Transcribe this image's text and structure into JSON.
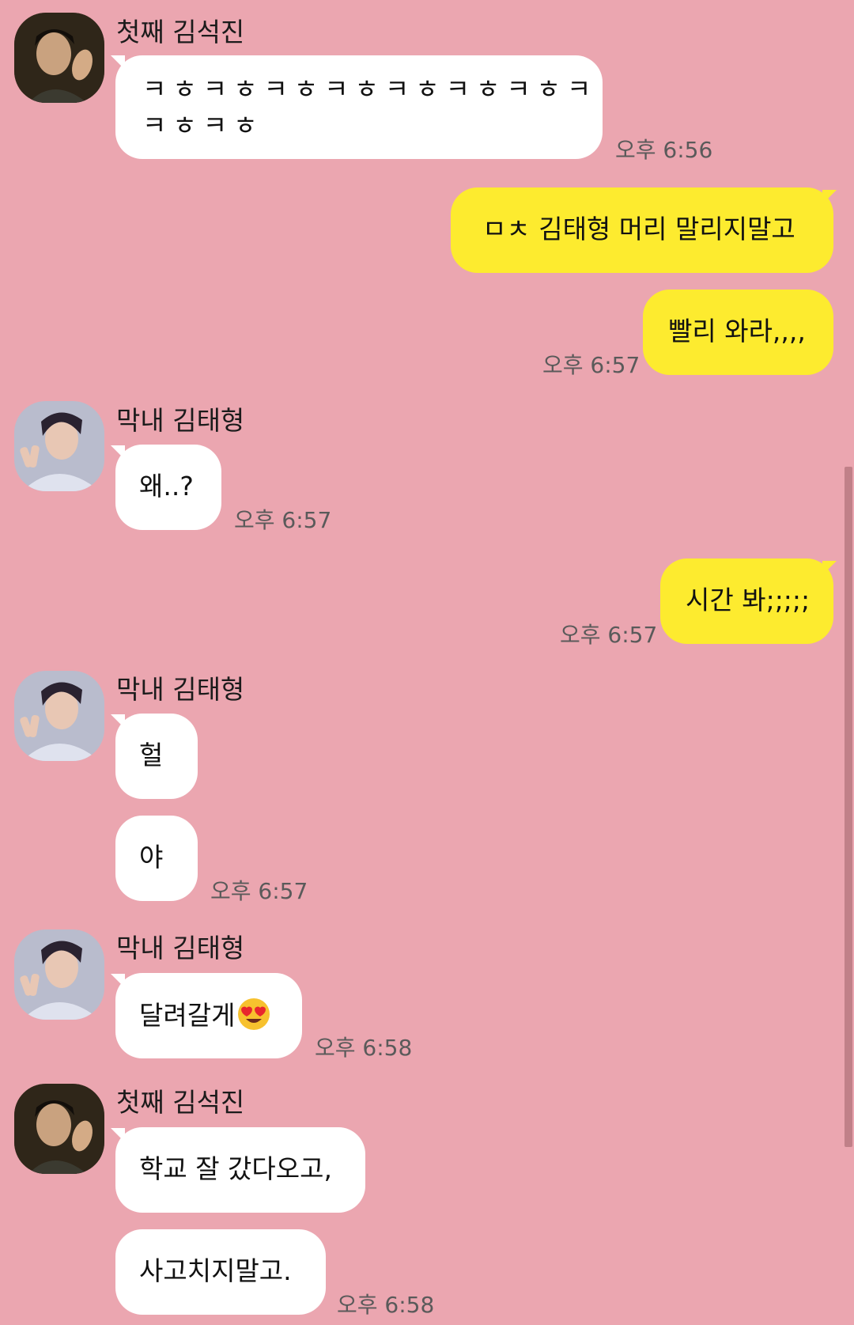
{
  "senders": {
    "jin": "첫째 김석진",
    "v": "막내 김태형"
  },
  "messages": {
    "m1_line1": "ㅋㅎㅋㅎㅋㅎㅋㅎㅋㅎㅋㅎㅋㅎㅋ",
    "m1_line2": "ㅋㅎㅋㅎ",
    "m1_time": "오후 6:56",
    "m2": "ㅁㅊ 김태형 머리 말리지말고",
    "m3": "빨리 와라,,,,",
    "m3_time": "오후 6:57",
    "m4": "왜..?",
    "m4_time": "오후 6:57",
    "m5": "시간 봐;;;;;",
    "m5_time": "오후 6:57",
    "m6": "헐",
    "m7": "야",
    "m7_time": "오후 6:57",
    "m8": "달려갈게",
    "m8_emoji": "heart-eyes-emoji",
    "m8_time": "오후 6:58",
    "m9": "학교 잘 갔다오고,",
    "m10": "사고치지말고.",
    "m10_time": "오후 6:58"
  },
  "colors": {
    "background": "#eba6b0",
    "incoming_bubble": "#ffffff",
    "outgoing_bubble": "#fdeb2f"
  }
}
